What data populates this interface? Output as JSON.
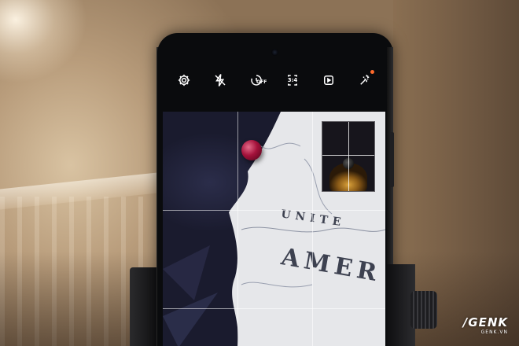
{
  "scene": {
    "description_colors": {
      "background": "#b89c7b",
      "phone_body": "#0a0b0d",
      "indicator_dot": "#ff6a2b"
    }
  },
  "camera_toolbar": {
    "icons": [
      {
        "name": "settings-icon"
      },
      {
        "name": "flash-off-icon"
      },
      {
        "name": "timer-icon",
        "label": "OFF"
      },
      {
        "name": "aspect-ratio-icon",
        "label": "3:4"
      },
      {
        "name": "motion-photo-icon"
      },
      {
        "name": "effects-icon"
      }
    ]
  },
  "viewfinder": {
    "map_text": "AMER",
    "map_text_small": "UNITE"
  },
  "watermark": {
    "logo": "/GENK",
    "url": "GENK.VN"
  }
}
